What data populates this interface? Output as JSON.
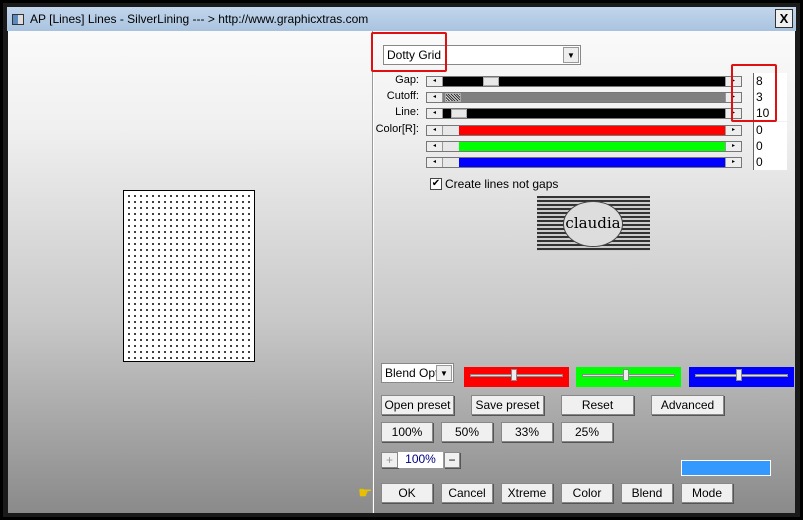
{
  "window": {
    "title": "AP [Lines]  Lines - SilverLining    --- > http://www.graphicxtras.com",
    "close_label": "X"
  },
  "preset": {
    "selected": "Dotty Grid"
  },
  "sliders": [
    {
      "label": "Gap:",
      "value": "8",
      "color": "#000000",
      "fill_color": "#000000"
    },
    {
      "label": "Cutoff:",
      "value": "3",
      "color": "#808080"
    },
    {
      "label": "Line:",
      "value": "10",
      "color": "#000000"
    },
    {
      "label": "Color[R]:",
      "value": "0",
      "color": "#ff0000"
    },
    {
      "label": "",
      "value": "0",
      "color": "#00ff00"
    },
    {
      "label": "",
      "value": "0",
      "color": "#0000ff"
    }
  ],
  "checkbox": {
    "label": "Create lines not gaps",
    "checked": true
  },
  "logo": {
    "text": "claudia"
  },
  "blend": {
    "selected": "Blend Opti"
  },
  "color_swatches": [
    "#ff0000",
    "#00ff00",
    "#0000ff"
  ],
  "buttons": {
    "open_preset": "Open preset",
    "save_preset": "Save preset",
    "reset": "Reset",
    "advanced": "Advanced"
  },
  "zoom_buttons": [
    "100%",
    "50%",
    "33%",
    "25%"
  ],
  "zoom": {
    "value": "100%",
    "plus": "+",
    "minus": "−"
  },
  "color_preview": "#3399ff",
  "bottom_buttons": {
    "ok": "OK",
    "cancel": "Cancel",
    "xtreme": "Xtreme",
    "color": "Color",
    "blend": "Blend",
    "mode": "Mode"
  }
}
